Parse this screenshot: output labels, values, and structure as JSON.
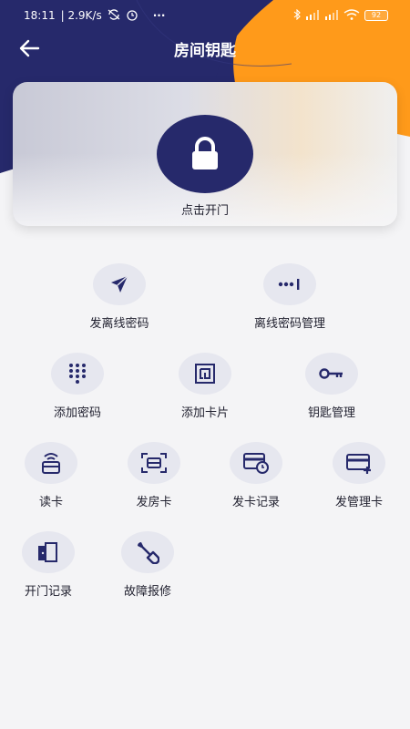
{
  "status_bar": {
    "time": "18:11",
    "speed": "| 2.9K/s",
    "battery": "92",
    "more": "···"
  },
  "nav": {
    "title": "房间钥匙"
  },
  "unlock": {
    "label": "点击开门"
  },
  "functions": [
    {
      "label": "发离线密码",
      "icon": "send-icon"
    },
    {
      "label": "离线密码管理",
      "icon": "password-dots-icon"
    },
    {
      "label": "添加密码",
      "icon": "keypad-icon"
    },
    {
      "label": "添加卡片",
      "icon": "card-chip-icon"
    },
    {
      "label": "钥匙管理",
      "icon": "key-icon"
    },
    {
      "label": "读卡",
      "icon": "card-read-icon"
    },
    {
      "label": "发房卡",
      "icon": "scan-card-icon"
    },
    {
      "label": "发卡记录",
      "icon": "card-history-icon"
    },
    {
      "label": "发管理卡",
      "icon": "add-card-icon"
    },
    {
      "label": "开门记录",
      "icon": "door-icon"
    },
    {
      "label": "故障报修",
      "icon": "wrench-icon"
    }
  ],
  "colors": {
    "navy": "#26296b",
    "orange": "#ff9a1a",
    "page_bg": "#f4f4f6",
    "icon_circle": "#e6e7ef"
  }
}
